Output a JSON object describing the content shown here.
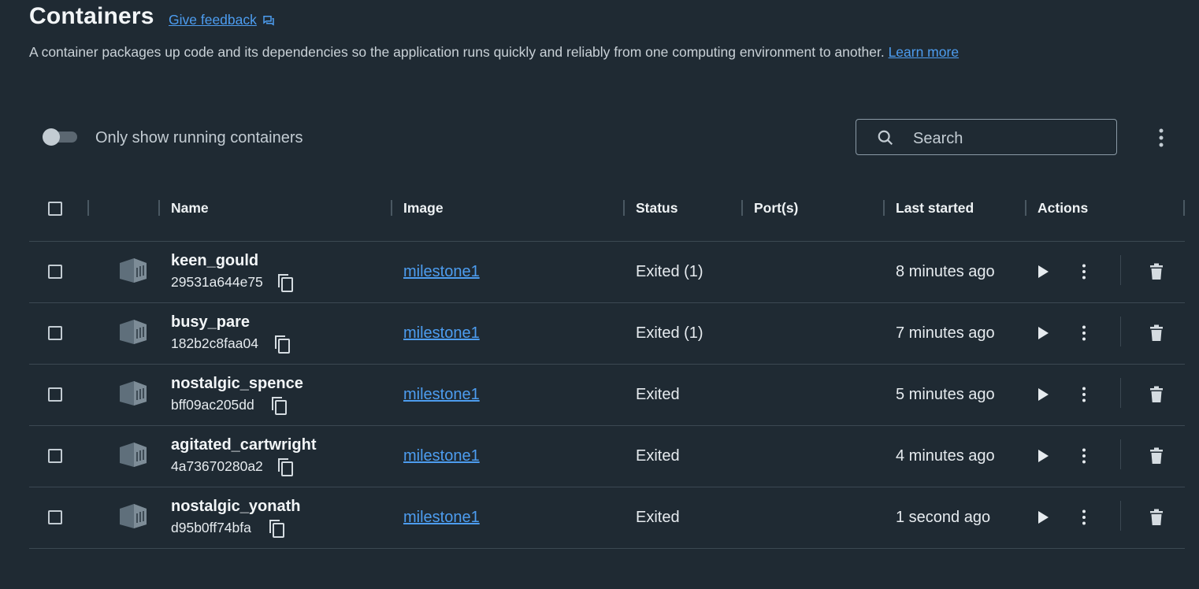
{
  "header": {
    "title": "Containers",
    "feedback_label": "Give feedback",
    "description": "A container packages up code and its dependencies so the application runs quickly and reliably from one computing environment to another.",
    "learn_more": "Learn more"
  },
  "toolbar": {
    "toggle_label": "Only show running containers",
    "toggle_on": false,
    "search_placeholder": "Search"
  },
  "table": {
    "columns": [
      "Name",
      "Image",
      "Status",
      "Port(s)",
      "Last started",
      "Actions"
    ],
    "rows": [
      {
        "name": "keen_gould",
        "id": "29531a644e75",
        "image": "milestone1",
        "status": "Exited (1)",
        "ports": "",
        "last_started": "8 minutes ago"
      },
      {
        "name": "busy_pare",
        "id": "182b2c8faa04",
        "image": "milestone1",
        "status": "Exited (1)",
        "ports": "",
        "last_started": "7 minutes ago"
      },
      {
        "name": "nostalgic_spence",
        "id": "bff09ac205dd",
        "image": "milestone1",
        "status": "Exited",
        "ports": "",
        "last_started": "5 minutes ago"
      },
      {
        "name": "agitated_cartwright",
        "id": "4a73670280a2",
        "image": "milestone1",
        "status": "Exited",
        "ports": "",
        "last_started": "4 minutes ago"
      },
      {
        "name": "nostalgic_yonath",
        "id": "d95b0ff74bfa",
        "image": "milestone1",
        "status": "Exited",
        "ports": "",
        "last_started": "1 second ago"
      }
    ]
  },
  "icons": {
    "feedback": "feedback-icon",
    "search": "search-icon",
    "more": "more-vertical-icon",
    "container": "container-icon",
    "copy": "copy-icon",
    "play": "play-icon",
    "trash": "trash-icon"
  },
  "colors": {
    "background": "#1f2a33",
    "accent": "#4d9df0",
    "text": "#e6ebef",
    "muted": "#c3ccd3"
  }
}
